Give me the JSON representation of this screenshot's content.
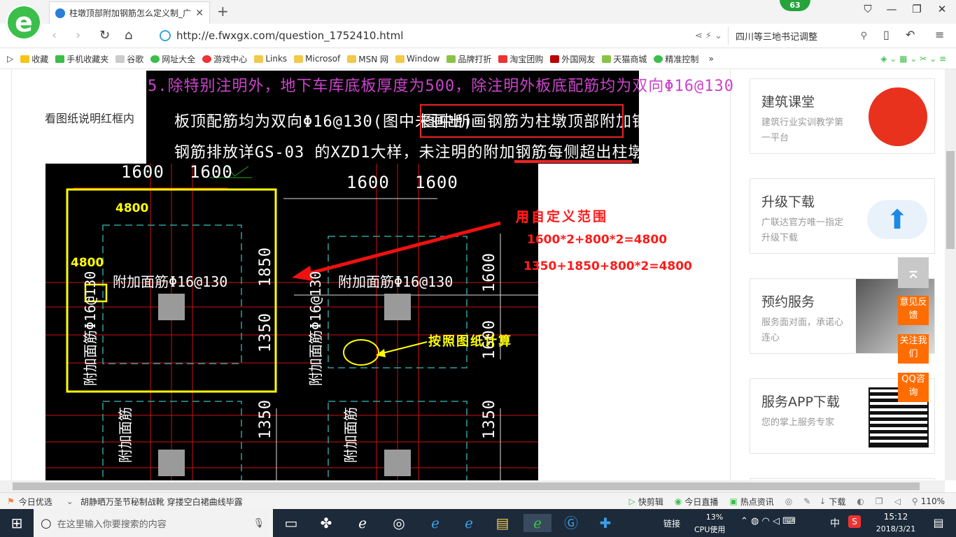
{
  "browser": {
    "tab_title": "柱墩顶部附加钢筋怎么定义制_广",
    "badge_count": "63",
    "url": "http://e.fwxgx.com/question_1752410.html",
    "search_text": "四川等三地书记调整",
    "bookmarks": [
      "收藏",
      "手机收藏夹",
      "谷歌",
      "网址大全",
      "游戏中心",
      "Links",
      "Microsof",
      "MSN 网",
      "Window",
      "品牌打折",
      "淘宝团购",
      "外国网友",
      "天猫商城",
      "精准控制"
    ]
  },
  "page": {
    "intro_text": "看图纸说明红框内",
    "notes": {
      "line1": "5.除特别注明外，地下车库底板厚度为500，除注明外板底配筋均为双向Φ16@130",
      "line2a": "板顶配筋均为双向Φ16@130(图中未画出)",
      "line2b": "图中所画钢筋为柱墩顶部附加钢筋,",
      "line3": "钢筋排放详GS-03 的XZD1大样，未注明的附加钢筋每侧超出柱墩长度为800."
    },
    "cad": {
      "top_dims": [
        "1600",
        "1600"
      ],
      "mid_dims": [
        "1600",
        "1600"
      ],
      "left_box_w": "4800",
      "left_box_h": "4800",
      "rebar_label_left": "附加面筋Φ16@130",
      "rebar_label_right": "附加面筋Φ16@130",
      "vert_label_left": "附加面筋Φ16@130",
      "vert_label_right": "附加面筋Φ16@130",
      "lower_vert_left": "附加面筋",
      "lower_vert_right": "附加面筋",
      "dim_1850": "1850",
      "dim_1350": "1350",
      "dim_1350_b": "1350",
      "dim_1600_r": "1600",
      "dim_1600_r2": "1600",
      "dim_1350_r": "1350",
      "dim_1600_r3": "1600",
      "annotation_title": "用自定义范围",
      "annotation_calc1": "1600*2+800*2=4800",
      "annotation_calc2": "1350+1850+800*2=4800",
      "annotation_drawing": "按照图纸计算",
      "colors": {
        "yellow": "#ffff00",
        "red": "#ff0000",
        "cyan": "#2fa0a0",
        "grey": "#9a9a9a"
      }
    }
  },
  "sidebar": {
    "cards": [
      {
        "title": "建筑课堂",
        "desc": "建筑行业实训教学第一平台"
      },
      {
        "title": "升级下载",
        "desc": "广联达官方唯一指定升级下载"
      },
      {
        "title": "预约服务",
        "desc": "服务面对面，承诺心连心"
      },
      {
        "title": "服务APP下载",
        "desc": "您的掌上服务专家"
      }
    ],
    "float_buttons": [
      "意见反馈",
      "关注我们",
      "QQ咨询"
    ]
  },
  "statusbar": {
    "left": "今日优选",
    "headline": "胡静晒万圣节秘制战靴 穿搂空白裙曲线毕露",
    "items": [
      "快剪辑",
      "今日直播",
      "热点资讯",
      "下载"
    ],
    "zoom": "110%"
  },
  "taskbar": {
    "search_placeholder": "在这里输入你要搜索的内容",
    "link_label": "链接",
    "cpu_percent": "13%",
    "cpu_label": "CPU使用",
    "ime": "中",
    "time": "15:12",
    "date": "2018/3/21"
  }
}
